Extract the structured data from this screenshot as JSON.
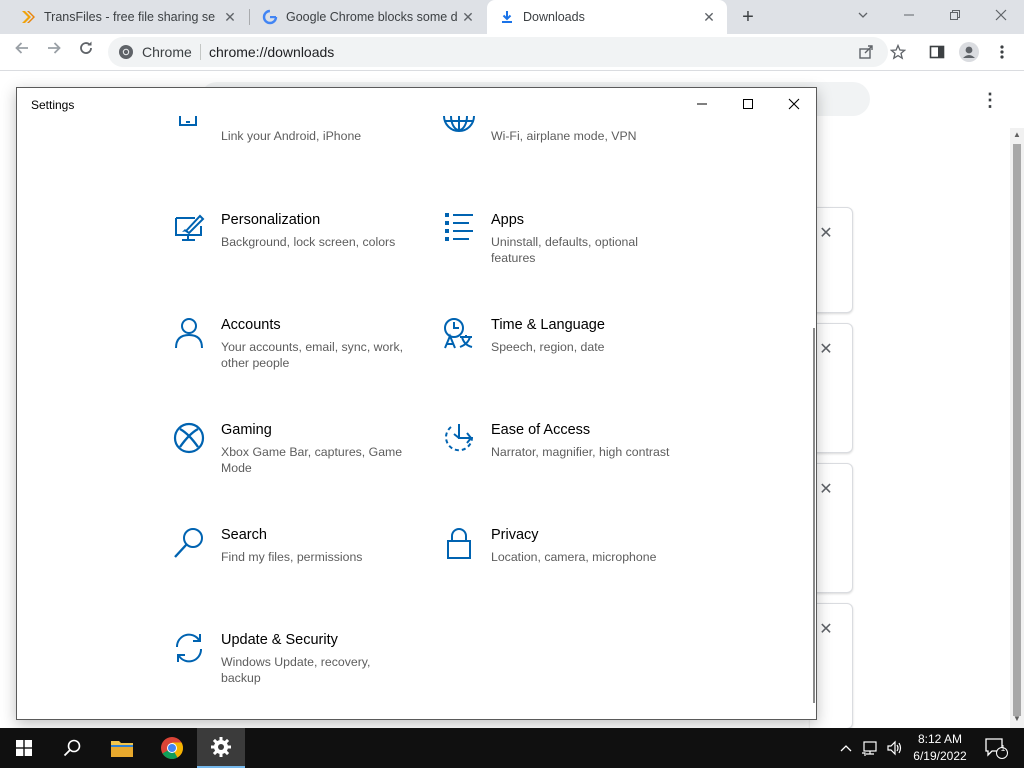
{
  "browser": {
    "tabs": [
      {
        "title": "TransFiles - free file sharing servi",
        "icon": "transfiles-icon"
      },
      {
        "title": "Google Chrome blocks some dow",
        "icon": "google-icon"
      },
      {
        "title": "Downloads",
        "icon": "download-icon"
      }
    ],
    "active_tab": 2,
    "omnibox_label": "Chrome",
    "url": "chrome://downloads"
  },
  "settings": {
    "window_title": "Settings",
    "items": [
      {
        "title": "",
        "desc": "Link your Android, iPhone",
        "icon": "phone-icon"
      },
      {
        "title": "",
        "desc": "Wi-Fi, airplane mode, VPN",
        "icon": "globe-icon"
      },
      {
        "title": "Personalization",
        "desc": "Background, lock screen, colors",
        "icon": "personalization-icon"
      },
      {
        "title": "Apps",
        "desc": "Uninstall, defaults, optional features",
        "icon": "apps-icon"
      },
      {
        "title": "Accounts",
        "desc": "Your accounts, email, sync, work, other people",
        "icon": "person-icon"
      },
      {
        "title": "Time & Language",
        "desc": "Speech, region, date",
        "icon": "time-language-icon"
      },
      {
        "title": "Gaming",
        "desc": "Xbox Game Bar, captures, Game Mode",
        "icon": "xbox-icon"
      },
      {
        "title": "Ease of Access",
        "desc": "Narrator, magnifier, high contrast",
        "icon": "ease-of-access-icon"
      },
      {
        "title": "Search",
        "desc": "Find my files, permissions",
        "icon": "search-icon"
      },
      {
        "title": "Privacy",
        "desc": "Location, camera, microphone",
        "icon": "lock-icon"
      },
      {
        "title": "Update & Security",
        "desc": "Windows Update, recovery, backup",
        "icon": "update-icon"
      }
    ]
  },
  "taskbar": {
    "time": "8:12 AM",
    "date": "6/19/2022",
    "notification_count": "1"
  },
  "colors": {
    "accent": "#0063b1",
    "taskbar": "#101010",
    "tabstrip": "#dee1e6"
  }
}
